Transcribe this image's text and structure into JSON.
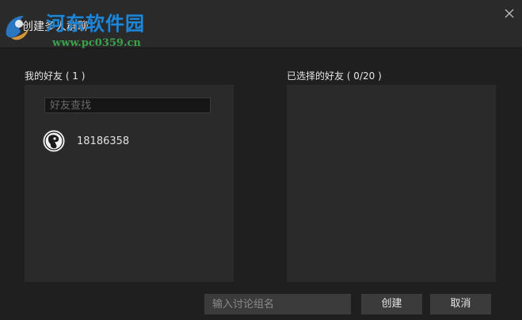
{
  "window": {
    "title": "创建多人群聊"
  },
  "watermark": {
    "site_name": "河东软件园",
    "url": "www.pc0359.cn"
  },
  "icons": {
    "close": "close-icon",
    "logo": "watermark-logo-icon",
    "avatar": "user-avatar-icon"
  },
  "left_panel": {
    "label": "我的好友 ( 1 )",
    "search_placeholder": "好友查找",
    "friends": [
      {
        "name": "18186358"
      }
    ]
  },
  "right_panel": {
    "label": "已选择的好友 ( 0/20 )"
  },
  "footer": {
    "group_name_placeholder": "输入讨论组名",
    "create_label": "创建",
    "cancel_label": "取消"
  },
  "colors": {
    "background": "#1f1f20",
    "panel": "#2a2a2b",
    "button": "#3b3b3c",
    "watermark_blue": "#1f86d6",
    "watermark_green": "#3aa34a"
  }
}
